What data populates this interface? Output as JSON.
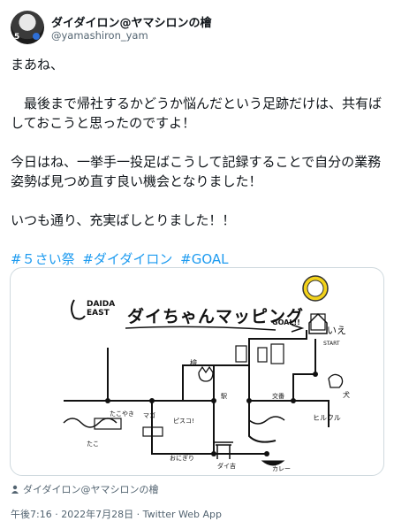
{
  "user": {
    "display_name": "ダイダイロン@ヤマシロンの檜",
    "handle": "@yamashiron_yam",
    "avatar_badge": "5"
  },
  "tweet": {
    "paragraphs": [
      "まあね、",
      "　最後まで帰社するかどうか悩んだという足跡だけは、共有ばしておこうと思ったのですよ！",
      "今日はね、一挙手一投足ばこうして記録することで自分の業務姿勢ば見つめ直す良い機会となりました！",
      "いつも通り、充実ばしとりました！！"
    ],
    "hashtags": [
      "#５さい祭",
      "#ダイダイロン",
      "#GOAL"
    ]
  },
  "media": {
    "logo_line1": "DAIDA",
    "logo_line2": "EAST",
    "map_title": "ダイちゃんマッピング",
    "goal_label": "GOAL!!",
    "start_label": "START",
    "ie_label": "いえ",
    "labels": {
      "hinoki": "檜",
      "tako": "たこ",
      "inu": "犬",
      "higuruma": "ヒルクル",
      "takoyaki": "たこやき",
      "pizza": "ピスコ!",
      "mago": "マゴ",
      "onigiri": "おにぎり",
      "daikichi": "ダイ吉",
      "curry": "カレー",
      "koban": "交番",
      "station": "駅"
    }
  },
  "credit": {
    "icon": "person-icon",
    "text": "ダイダイロン@ヤマシロンの檜"
  },
  "meta": {
    "text": "午後7:16 · 2022年7月28日 · Twitter Web App"
  },
  "colors": {
    "link": "#1d9bf0",
    "secondary_text": "#536471",
    "border": "#cfd9de"
  }
}
